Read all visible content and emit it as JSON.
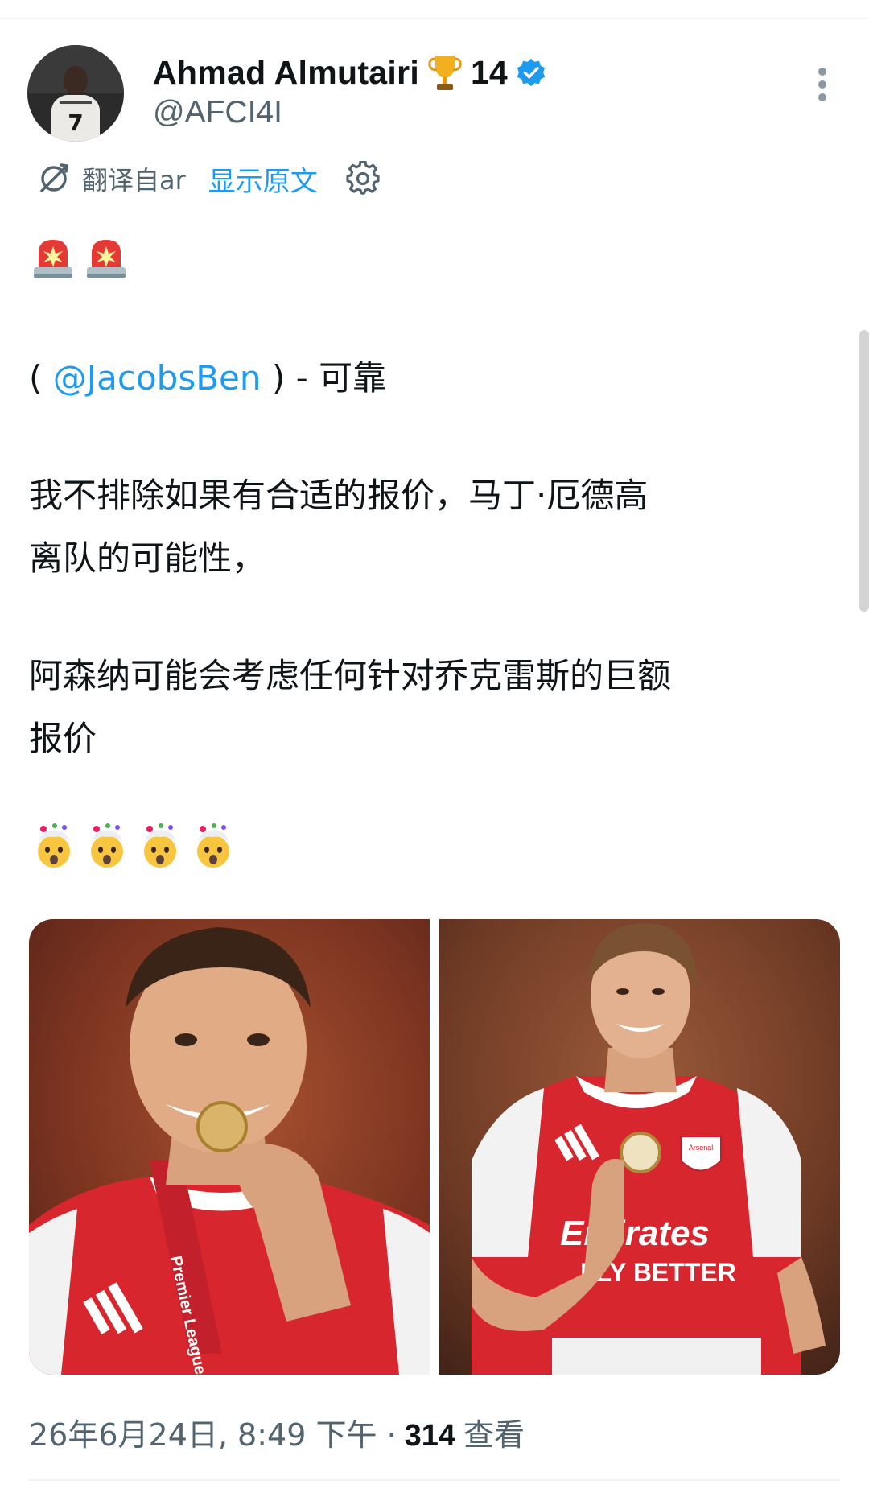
{
  "tweet": {
    "author": {
      "display_name": "Ahmad Almutairi",
      "badge_count": "14",
      "handle": "@AFCI4I",
      "avatar_shirt_number": "7"
    },
    "translation": {
      "translated_from": "翻译自ar",
      "show_original": "显示原文"
    },
    "text": {
      "mention_open": "( ",
      "mention": "@JacobsBen",
      "mention_close": " ) - 可靠",
      "line1": "我不排除如果有合适的报价，马丁·厄德高",
      "line2": "离队的可能性，",
      "line3": "阿森纳可能会考虑任何针对乔克雷斯的巨额",
      "line4": "报价"
    },
    "media": {
      "photo_left": {
        "medal_ribbon_text": "Premier League"
      },
      "photo_right": {
        "shirt_sponsor_line1": "Emirates",
        "shirt_sponsor_line2": "FLY BETTER",
        "crest_text": "Arsenal"
      }
    },
    "meta": {
      "timestamp": "26年6月24日, 8:49 下午 ·",
      "views_count": "314",
      "views_label": "查看"
    }
  },
  "colors": {
    "link": "#1d9bf0",
    "secondary_text": "#536471",
    "verified": "#1d9bf0",
    "arsenal_red": "#d8262e"
  },
  "icons": [
    "trophy-icon",
    "verified-badge-icon",
    "more-options-icon",
    "translate-icon",
    "settings-gear-icon",
    "siren-emoji",
    "exploding-head-emoji"
  ]
}
